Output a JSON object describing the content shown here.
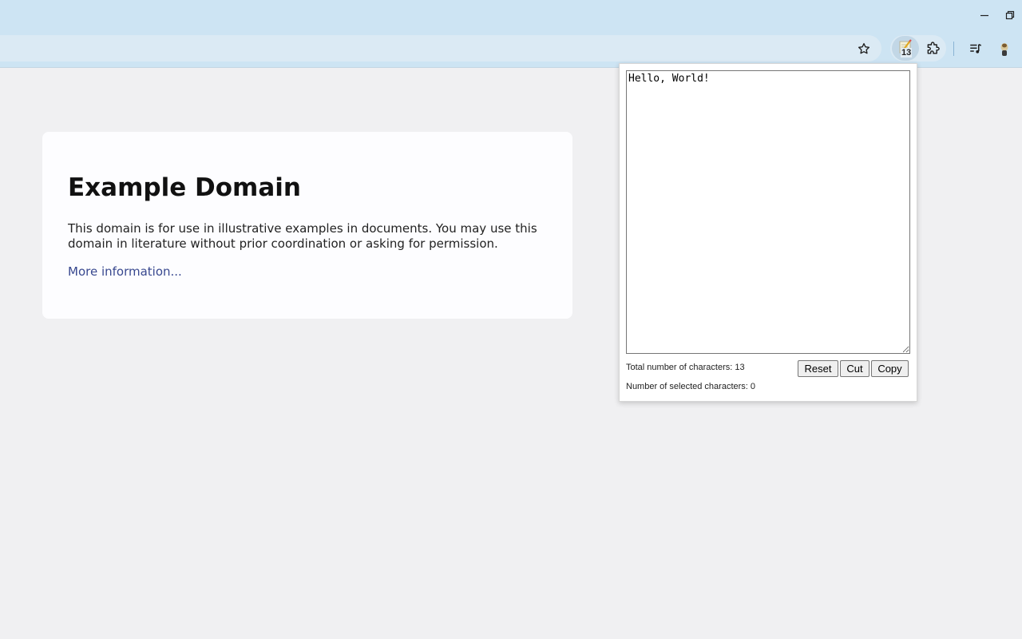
{
  "page": {
    "heading": "Example Domain",
    "description": "This domain is for use in illustrative examples in documents. You may use this domain in literature without prior coordination or asking for permission.",
    "link_text": "More information..."
  },
  "toolbar": {
    "extension_badge": "13",
    "icons": [
      "bookmark-star-icon",
      "extension-notepad-icon",
      "puzzle-icon",
      "media-control-icon",
      "profile-icon"
    ]
  },
  "popup": {
    "textarea_value": "Hello, World!",
    "total_label": "Total number of characters: 13",
    "selected_label": "Number of selected characters: 0",
    "reset_label": "Reset",
    "cut_label": "Cut",
    "copy_label": "Copy"
  },
  "colors": {
    "chrome_bg": "#cde4f3",
    "page_bg": "#f0f0f2",
    "link": "#38488f"
  }
}
